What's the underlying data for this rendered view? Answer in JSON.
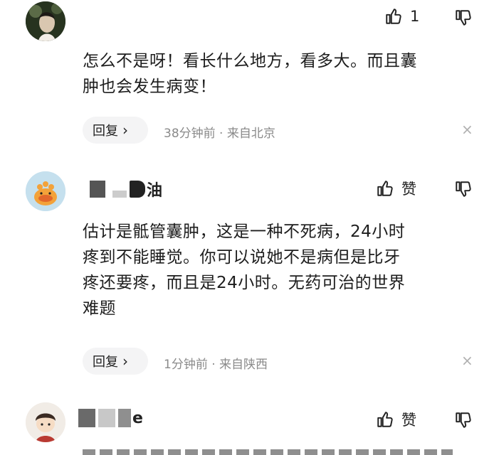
{
  "comments": [
    {
      "like_count": "1",
      "text_lines": [
        "怎么不是呀！看长什么地方，看多大。而且囊",
        "肿也会发生病变！"
      ],
      "reply_label": "回复",
      "chevron": "›",
      "meta": "38分钟前 · 来自北京"
    },
    {
      "username_visible": "油",
      "like_label": "赞",
      "text_lines": [
        "估计是骶管囊肿，这是一种不死病，24小时",
        "疼到不能睡觉。你可以说她不是病但是比牙",
        "疼还要疼，而且是24小时。无药可治的世界",
        "难题"
      ],
      "reply_label": "回复",
      "chevron": "›",
      "meta": "1分钟前 · 来自陕西"
    },
    {
      "username_visible": "e",
      "like_label": "赞"
    }
  ],
  "icons": {
    "like": "thumbs-up-icon",
    "dislike": "thumbs-down-icon",
    "close": "close-icon",
    "close_glyph": "×"
  },
  "colors": {
    "meta_gray": "#8a8a8a",
    "reply_bg": "#f4f4f5"
  }
}
